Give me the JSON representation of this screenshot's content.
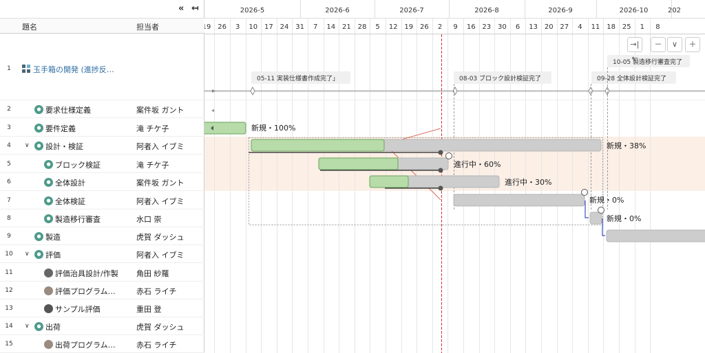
{
  "toolbar": {
    "collapse_icon": "«",
    "collapse_to_edge_icon": "↤"
  },
  "table_header": {
    "name": "題名",
    "assignee": "担当者"
  },
  "rows": [
    {
      "num": "1",
      "name": "玉手箱の開発 (進捗反…",
      "assignee": "",
      "icon": "grid-icon"
    },
    {
      "num": "2",
      "name": "要求仕様定義",
      "assignee": "案件坂 ガント",
      "icon": "task-icon"
    },
    {
      "num": "3",
      "name": "要件定義",
      "assignee": "滝 チケ子",
      "icon": "task-icon"
    },
    {
      "num": "4",
      "name": "設計・検証",
      "assignee": "阿者入 イブミ",
      "icon": "task-icon",
      "expand": "∨"
    },
    {
      "num": "5",
      "name": "ブロック検証",
      "assignee": "滝 チケ子",
      "icon": "task-icon"
    },
    {
      "num": "6",
      "name": "全体設計",
      "assignee": "案件坂 ガント",
      "icon": "task-icon"
    },
    {
      "num": "7",
      "name": "全体検証",
      "assignee": "阿者入 イブミ",
      "icon": "task-icon"
    },
    {
      "num": "8",
      "name": "製造移行審査",
      "assignee": "水口 崇",
      "icon": "task-icon"
    },
    {
      "num": "9",
      "name": "製造",
      "assignee": "虎賀 ダッシュ",
      "icon": "task-icon"
    },
    {
      "num": "10",
      "name": "評価",
      "assignee": "阿者入 イブミ",
      "icon": "task-icon",
      "expand": "∨"
    },
    {
      "num": "11",
      "name": "評価治具設計/作製",
      "assignee": "角田 紗羅",
      "icon": "avatar-icon"
    },
    {
      "num": "12",
      "name": "評価プログラム…",
      "assignee": "赤石 ライチ",
      "icon": "avatar-icon"
    },
    {
      "num": "13",
      "name": "サンプル評価",
      "assignee": "重田 登",
      "icon": "avatar-icon"
    },
    {
      "num": "14",
      "name": "出荷",
      "assignee": "虎賀 ダッシュ",
      "icon": "task-icon",
      "expand": "∨"
    },
    {
      "num": "15",
      "name": "出荷プログラム…",
      "assignee": "赤石 ライチ",
      "icon": "avatar-icon"
    }
  ],
  "timeline": {
    "months": [
      "2026-5",
      "2026-6",
      "2026-7",
      "2026-8",
      "2026-9",
      "2026-10",
      "202"
    ],
    "days": [
      "19",
      "26",
      "3",
      "10",
      "17",
      "24",
      "31",
      "7",
      "14",
      "21",
      "28",
      "5",
      "12",
      "19",
      "26",
      "2",
      "9",
      "16",
      "23",
      "30",
      "6",
      "13",
      "20",
      "27",
      "4",
      "11",
      "18",
      "25",
      "1",
      "8"
    ]
  },
  "milestones": [
    {
      "label": "05-11 実装仕様書作成完了」"
    },
    {
      "label": "08-03 ブロック設計検証完了"
    },
    {
      "label": "09-28 全体設計検証完了"
    },
    {
      "label": "10-05 製造移行審査完了"
    }
  ],
  "bar_labels": {
    "r3": "新規・100%",
    "r4": "新規・38%",
    "r5": "進行中・60%",
    "r6": "進行中・30%",
    "r7": "新規・0%",
    "r8": "新規・0%"
  },
  "zoom": {
    "fit_icon": "→|←",
    "zoom_out_icon": "－",
    "menu_icon": "∨",
    "zoom_in_icon": "＋"
  },
  "colors": {
    "progress": "#b7dba9",
    "remaining": "#cdcdcd",
    "today": "#d33333",
    "highlight": "#fcefe6"
  }
}
